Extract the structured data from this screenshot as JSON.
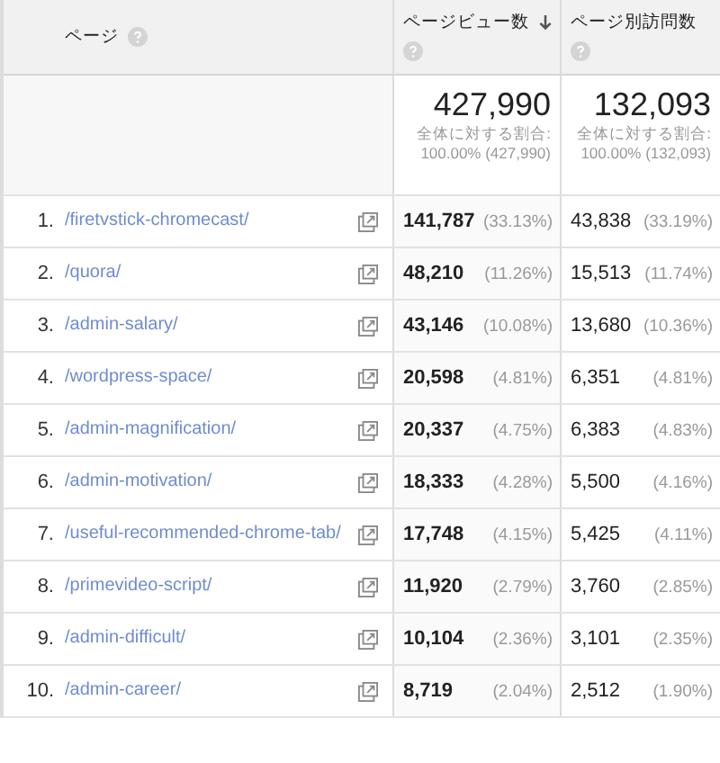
{
  "columns": [
    {
      "label": "ページ",
      "sorted": false
    },
    {
      "label": "ページビュー数",
      "sorted": true
    },
    {
      "label": "ページ別訪問数",
      "sorted": false
    }
  ],
  "totals": [
    {
      "value": "427,990",
      "note": "全体に対する割合: 100.00% (427,990)"
    },
    {
      "value": "132,093",
      "note": "全体に対する割合: 100.00% (132,093)"
    }
  ],
  "rows": [
    {
      "rank": "1.",
      "page": "/firetvstick-chromecast/",
      "views": "141,787",
      "views_pct": "(33.13%)",
      "visits": "43,838",
      "visits_pct": "(33.19%)"
    },
    {
      "rank": "2.",
      "page": "/quora/",
      "views": "48,210",
      "views_pct": "(11.26%)",
      "visits": "15,513",
      "visits_pct": "(11.74%)"
    },
    {
      "rank": "3.",
      "page": "/admin-salary/",
      "views": "43,146",
      "views_pct": "(10.08%)",
      "visits": "13,680",
      "visits_pct": "(10.36%)"
    },
    {
      "rank": "4.",
      "page": "/wordpress-space/",
      "views": "20,598",
      "views_pct": "(4.81%)",
      "visits": "6,351",
      "visits_pct": "(4.81%)"
    },
    {
      "rank": "5.",
      "page": "/admin-magnification/",
      "views": "20,337",
      "views_pct": "(4.75%)",
      "visits": "6,383",
      "visits_pct": "(4.83%)"
    },
    {
      "rank": "6.",
      "page": "/admin-motivation/",
      "views": "18,333",
      "views_pct": "(4.28%)",
      "visits": "5,500",
      "visits_pct": "(4.16%)"
    },
    {
      "rank": "7.",
      "page": "/useful-recommended-chrome-tab/",
      "views": "17,748",
      "views_pct": "(4.15%)",
      "visits": "5,425",
      "visits_pct": "(4.11%)"
    },
    {
      "rank": "8.",
      "page": "/primevideo-script/",
      "views": "11,920",
      "views_pct": "(2.79%)",
      "visits": "3,760",
      "visits_pct": "(2.85%)"
    },
    {
      "rank": "9.",
      "page": "/admin-difficult/",
      "views": "10,104",
      "views_pct": "(2.36%)",
      "visits": "3,101",
      "visits_pct": "(2.35%)"
    },
    {
      "rank": "10.",
      "page": "/admin-career/",
      "views": "8,719",
      "views_pct": "(2.04%)",
      "visits": "2,512",
      "visits_pct": "(1.90%)"
    }
  ]
}
